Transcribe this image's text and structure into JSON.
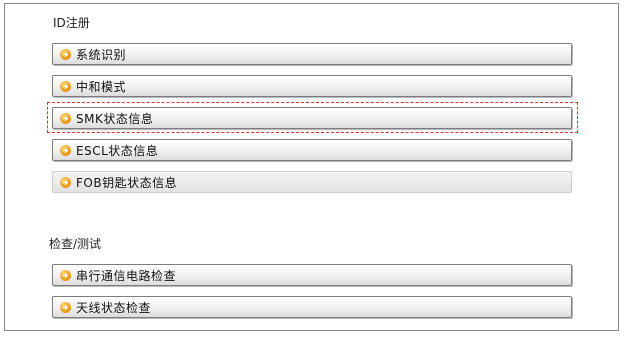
{
  "sections": [
    {
      "title": "ID注册",
      "items": [
        {
          "label": "系统识别",
          "enabled": true
        },
        {
          "label": "中和模式",
          "enabled": true
        },
        {
          "label": "SMK状态信息",
          "enabled": true,
          "selected": true
        },
        {
          "label": "ESCL状态信息",
          "enabled": true
        },
        {
          "label": "FOB钥匙状态信息",
          "enabled": false
        }
      ]
    },
    {
      "title": "检查/测试",
      "items": [
        {
          "label": "串行通信电路检查",
          "enabled": true
        },
        {
          "label": "天线状态检查",
          "enabled": true
        }
      ]
    }
  ],
  "icons": {
    "bullet": "orange-arrow-circle-icon"
  },
  "colors": {
    "bullet": "#f0a21a",
    "selection_outline": "#e03030",
    "frame_border": "#8a8a8a"
  }
}
